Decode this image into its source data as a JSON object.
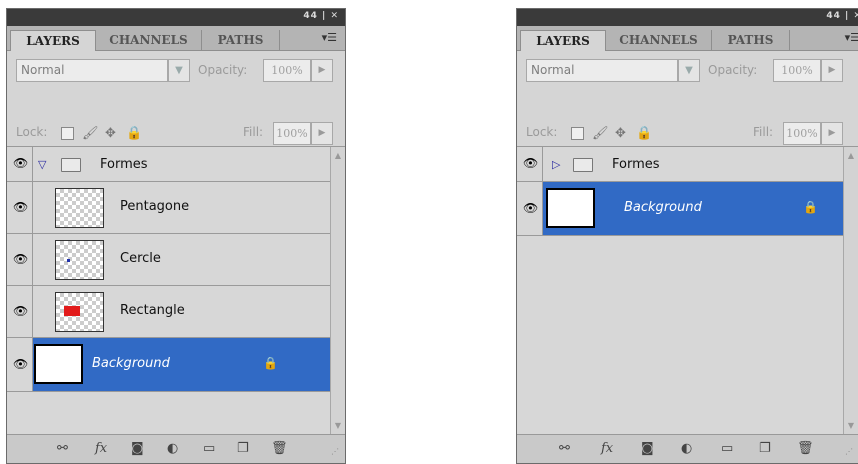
{
  "panels": [
    {
      "state": "expanded",
      "title_controls": "44 | ✕",
      "tabs": [
        "LAYERS",
        "CHANNELS",
        "PATHS"
      ],
      "active_tab": "LAYERS",
      "blend_mode": "Normal",
      "opacity_label": "Opacity:",
      "opacity_value": "100%",
      "lock_label": "Lock:",
      "fill_label": "Fill:",
      "fill_value": "100%",
      "layers": [
        {
          "name": "Formes",
          "kind": "group",
          "expanded": true
        },
        {
          "name": "Pentagone",
          "kind": "layer",
          "content": "empty"
        },
        {
          "name": "Cercle",
          "kind": "layer",
          "content": "dot"
        },
        {
          "name": "Rectangle",
          "kind": "layer",
          "content": "red-rect"
        },
        {
          "name": "Background",
          "kind": "background",
          "selected": true,
          "locked": true
        }
      ]
    },
    {
      "state": "collapsed",
      "title_controls": "44 | ✕",
      "tabs": [
        "LAYERS",
        "CHANNELS",
        "PATHS"
      ],
      "active_tab": "LAYERS",
      "blend_mode": "Normal",
      "opacity_label": "Opacity:",
      "opacity_value": "100%",
      "lock_label": "Lock:",
      "fill_label": "Fill:",
      "fill_value": "100%",
      "layers": [
        {
          "name": "Formes",
          "kind": "group",
          "expanded": false
        },
        {
          "name": "Background",
          "kind": "background",
          "selected": true,
          "locked": true
        }
      ]
    }
  ],
  "icons": {
    "eye": "eye-icon",
    "link": "link-layers-icon",
    "fx": "fx",
    "mask": "add-mask-icon",
    "adjust": "adjustment-layer-icon",
    "group": "new-group-icon",
    "new": "new-layer-icon",
    "trash": "trash-icon"
  },
  "colors": {
    "selection": "#316ac5",
    "panel_bg": "#d5d5d5",
    "titlebar": "#3a3a3a",
    "rect_fill": "#e21b1b"
  }
}
